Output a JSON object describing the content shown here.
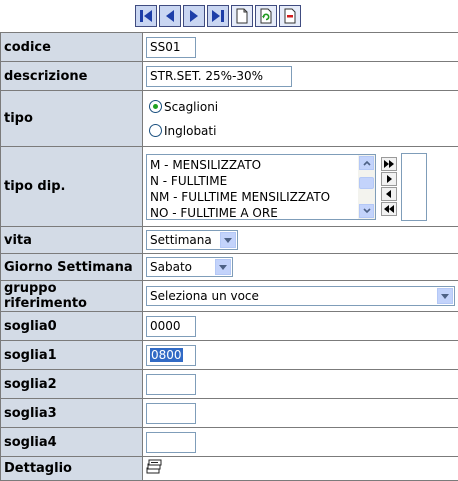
{
  "toolbar": {
    "buttons": [
      "first-icon",
      "previous-icon",
      "next-icon",
      "last-icon",
      "new-record-icon",
      "refresh-icon",
      "delete-icon"
    ]
  },
  "fields": {
    "codice": {
      "label": "codice",
      "value": "SS01"
    },
    "descrizione": {
      "label": "descrizione",
      "value": "STR.SET. 25%-30%"
    },
    "tipo": {
      "label": "tipo",
      "options": [
        "Scaglioni",
        "Inglobati"
      ],
      "selected": "Scaglioni"
    },
    "tipo_dip": {
      "label": "tipo dip.",
      "items": [
        "M - MENSILIZZATO",
        "N - FULLTIME",
        "NM - FULLTIME MENSILIZZATO",
        "NO - FULLTIME A ORE"
      ]
    },
    "vita": {
      "label": "vita",
      "value": "Settimana"
    },
    "giorno_settimana": {
      "label": "Giorno Settimana",
      "value": "Sabato"
    },
    "gruppo_riferimento": {
      "label": "gruppo riferimento",
      "value": "Seleziona un voce"
    },
    "soglia0": {
      "label": "soglia0",
      "value": "0000"
    },
    "soglia1": {
      "label": "soglia1",
      "value": "0800"
    },
    "soglia2": {
      "label": "soglia2",
      "value": ""
    },
    "soglia3": {
      "label": "soglia3",
      "value": ""
    },
    "soglia4": {
      "label": "soglia4",
      "value": ""
    },
    "dettaglio": {
      "label": "Dettaglio",
      "icon": "detail-stack-icon"
    }
  },
  "colors": {
    "label_bg": "#d3dbe6",
    "border": "#7b7b7b",
    "accent": "#316ac5"
  }
}
